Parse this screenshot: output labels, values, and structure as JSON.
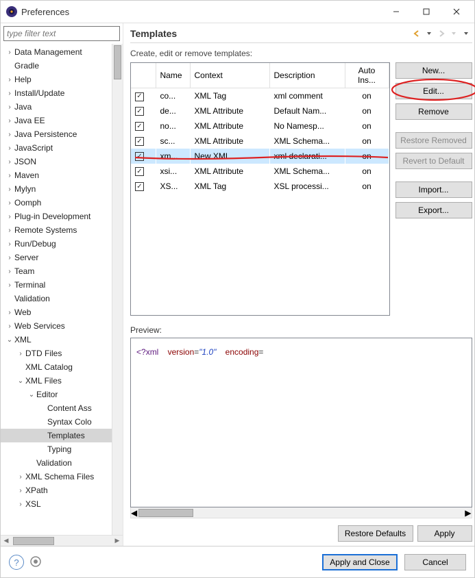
{
  "window": {
    "title": "Preferences"
  },
  "filter_placeholder": "type filter text",
  "tree": [
    {
      "l": "Data Management",
      "d": 0,
      "t": ">"
    },
    {
      "l": "Gradle",
      "d": 0,
      "t": ""
    },
    {
      "l": "Help",
      "d": 0,
      "t": ">"
    },
    {
      "l": "Install/Update",
      "d": 0,
      "t": ">"
    },
    {
      "l": "Java",
      "d": 0,
      "t": ">"
    },
    {
      "l": "Java EE",
      "d": 0,
      "t": ">"
    },
    {
      "l": "Java Persistence",
      "d": 0,
      "t": ">"
    },
    {
      "l": "JavaScript",
      "d": 0,
      "t": ">"
    },
    {
      "l": "JSON",
      "d": 0,
      "t": ">"
    },
    {
      "l": "Maven",
      "d": 0,
      "t": ">"
    },
    {
      "l": "Mylyn",
      "d": 0,
      "t": ">"
    },
    {
      "l": "Oomph",
      "d": 0,
      "t": ">"
    },
    {
      "l": "Plug-in Development",
      "d": 0,
      "t": ">"
    },
    {
      "l": "Remote Systems",
      "d": 0,
      "t": ">"
    },
    {
      "l": "Run/Debug",
      "d": 0,
      "t": ">"
    },
    {
      "l": "Server",
      "d": 0,
      "t": ">"
    },
    {
      "l": "Team",
      "d": 0,
      "t": ">"
    },
    {
      "l": "Terminal",
      "d": 0,
      "t": ">"
    },
    {
      "l": "Validation",
      "d": 0,
      "t": ""
    },
    {
      "l": "Web",
      "d": 0,
      "t": ">"
    },
    {
      "l": "Web Services",
      "d": 0,
      "t": ">"
    },
    {
      "l": "XML",
      "d": 0,
      "t": "v"
    },
    {
      "l": "DTD Files",
      "d": 1,
      "t": ">"
    },
    {
      "l": "XML Catalog",
      "d": 1,
      "t": ""
    },
    {
      "l": "XML Files",
      "d": 1,
      "t": "v"
    },
    {
      "l": "Editor",
      "d": 2,
      "t": "v"
    },
    {
      "l": "Content Ass",
      "d": 3,
      "t": ""
    },
    {
      "l": "Syntax Colo",
      "d": 3,
      "t": ""
    },
    {
      "l": "Templates",
      "d": 3,
      "t": "",
      "sel": true
    },
    {
      "l": "Typing",
      "d": 3,
      "t": ""
    },
    {
      "l": "Validation",
      "d": 2,
      "t": ""
    },
    {
      "l": "XML Schema Files",
      "d": 1,
      "t": ">"
    },
    {
      "l": "XPath",
      "d": 1,
      "t": ">"
    },
    {
      "l": "XSL",
      "d": 1,
      "t": ">"
    }
  ],
  "page": {
    "title": "Templates",
    "desc": "Create, edit or remove templates:"
  },
  "columns": {
    "name": "Name",
    "context": "Context",
    "desc": "Description",
    "auto": "Auto Ins..."
  },
  "rows": [
    {
      "name": "co...",
      "ctx": "XML Tag",
      "desc": "xml comment",
      "auto": "on"
    },
    {
      "name": "de...",
      "ctx": "XML Attribute",
      "desc": "Default Nam...",
      "auto": "on"
    },
    {
      "name": "no...",
      "ctx": "XML Attribute",
      "desc": "No Namesp...",
      "auto": "on"
    },
    {
      "name": "sc...",
      "ctx": "XML Attribute",
      "desc": "XML Schema...",
      "auto": "on"
    },
    {
      "name": "xm...",
      "ctx": "New XML",
      "desc": "xml declarati...",
      "auto": "on",
      "sel": true
    },
    {
      "name": "xsi...",
      "ctx": "XML Attribute",
      "desc": "XML Schema...",
      "auto": "on"
    },
    {
      "name": "XS...",
      "ctx": "XML Tag",
      "desc": "XSL processi...",
      "auto": "on"
    }
  ],
  "buttons": {
    "new": "New...",
    "edit": "Edit...",
    "remove": "Remove",
    "restore_removed": "Restore Removed",
    "revert": "Revert to Default",
    "import": "Import...",
    "export": "Export...",
    "restore_defaults": "Restore Defaults",
    "apply": "Apply",
    "apply_close": "Apply and Close",
    "cancel": "Cancel"
  },
  "preview": {
    "label": "Preview:",
    "piOpen": "<?",
    "piName": "xml",
    "attr1": "version",
    "eq": "=",
    "val1": "\"1.0\"",
    "attr2": "encoding"
  }
}
